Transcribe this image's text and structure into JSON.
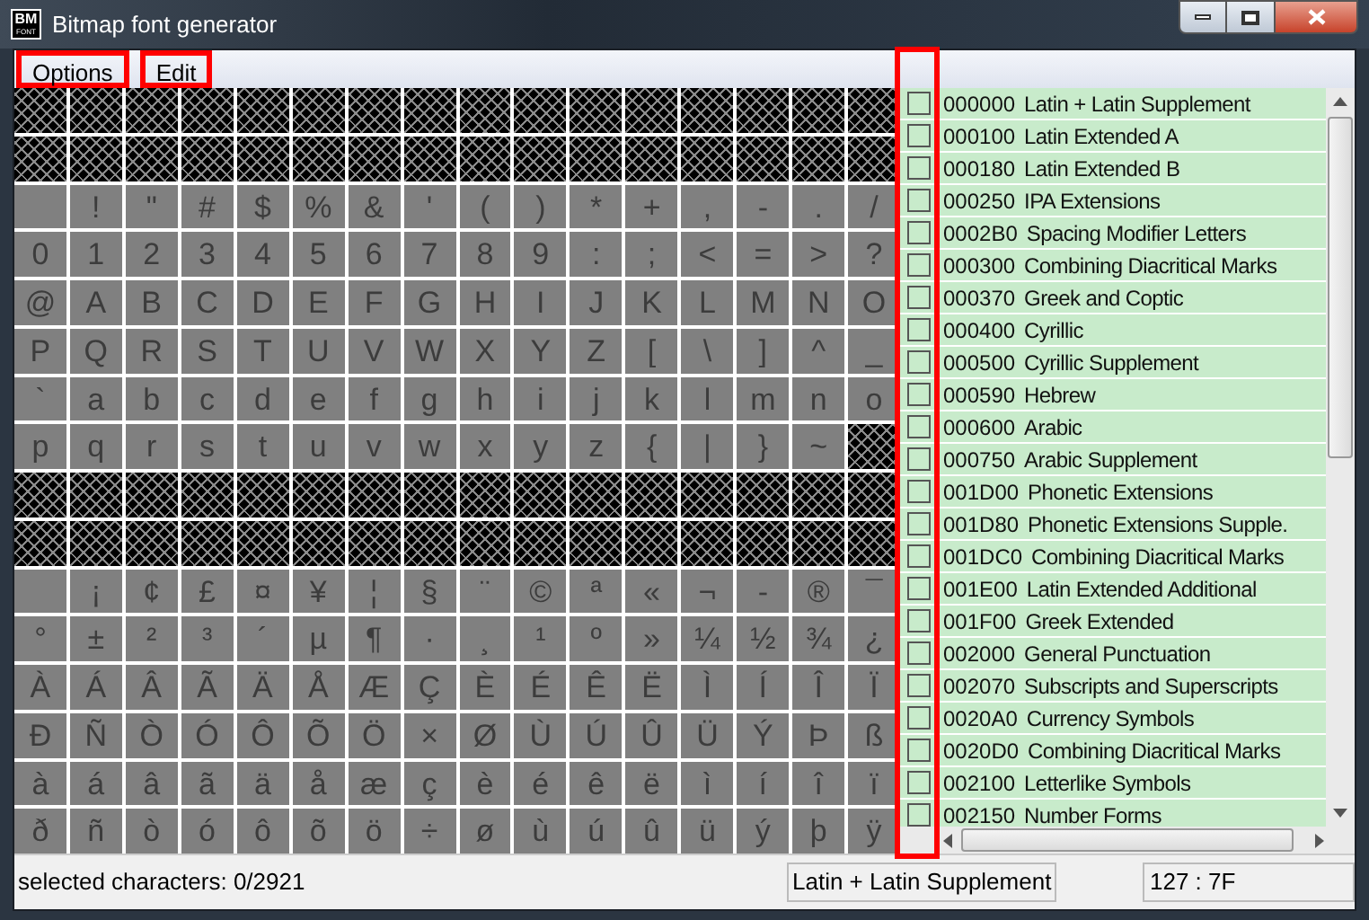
{
  "window": {
    "title": "Bitmap font generator",
    "app_icon": {
      "top": "BM",
      "bottom": "FONT"
    }
  },
  "menu": [
    {
      "label": "Options",
      "highlighted": true
    },
    {
      "label": "Edit",
      "highlighted": true
    }
  ],
  "glyph_grid": {
    "rows": [
      {
        "kind": "unavailable"
      },
      {
        "kind": "unavailable"
      },
      {
        "kind": "glyphs",
        "cells": [
          {
            "kind": "space"
          },
          {
            "kind": "glyph",
            "char": "!"
          },
          {
            "kind": "glyph",
            "char": "\""
          },
          {
            "kind": "glyph",
            "char": "#"
          },
          {
            "kind": "glyph",
            "char": "$"
          },
          {
            "kind": "glyph",
            "char": "%"
          },
          {
            "kind": "glyph",
            "char": "&"
          },
          {
            "kind": "glyph",
            "char": "'"
          },
          {
            "kind": "glyph",
            "char": "("
          },
          {
            "kind": "glyph",
            "char": ")"
          },
          {
            "kind": "glyph",
            "char": "*"
          },
          {
            "kind": "glyph",
            "char": "+"
          },
          {
            "kind": "glyph",
            "char": ","
          },
          {
            "kind": "glyph",
            "char": "-"
          },
          {
            "kind": "glyph",
            "char": "."
          },
          {
            "kind": "glyph",
            "char": "/"
          }
        ]
      },
      {
        "kind": "glyphs",
        "cells": [
          {
            "kind": "glyph",
            "char": "0"
          },
          {
            "kind": "glyph",
            "char": "1"
          },
          {
            "kind": "glyph",
            "char": "2"
          },
          {
            "kind": "glyph",
            "char": "3"
          },
          {
            "kind": "glyph",
            "char": "4"
          },
          {
            "kind": "glyph",
            "char": "5"
          },
          {
            "kind": "glyph",
            "char": "6"
          },
          {
            "kind": "glyph",
            "char": "7"
          },
          {
            "kind": "glyph",
            "char": "8"
          },
          {
            "kind": "glyph",
            "char": "9"
          },
          {
            "kind": "glyph",
            "char": ":"
          },
          {
            "kind": "glyph",
            "char": ";"
          },
          {
            "kind": "glyph",
            "char": "<"
          },
          {
            "kind": "glyph",
            "char": "="
          },
          {
            "kind": "glyph",
            "char": ">"
          },
          {
            "kind": "glyph",
            "char": "?"
          }
        ]
      },
      {
        "kind": "glyphs",
        "cells": [
          {
            "kind": "glyph",
            "char": "@"
          },
          {
            "kind": "glyph",
            "char": "A"
          },
          {
            "kind": "glyph",
            "char": "B"
          },
          {
            "kind": "glyph",
            "char": "C"
          },
          {
            "kind": "glyph",
            "char": "D"
          },
          {
            "kind": "glyph",
            "char": "E"
          },
          {
            "kind": "glyph",
            "char": "F"
          },
          {
            "kind": "glyph",
            "char": "G"
          },
          {
            "kind": "glyph",
            "char": "H"
          },
          {
            "kind": "glyph",
            "char": "I"
          },
          {
            "kind": "glyph",
            "char": "J"
          },
          {
            "kind": "glyph",
            "char": "K"
          },
          {
            "kind": "glyph",
            "char": "L"
          },
          {
            "kind": "glyph",
            "char": "M"
          },
          {
            "kind": "glyph",
            "char": "N"
          },
          {
            "kind": "glyph",
            "char": "O"
          }
        ]
      },
      {
        "kind": "glyphs",
        "cells": [
          {
            "kind": "glyph",
            "char": "P"
          },
          {
            "kind": "glyph",
            "char": "Q"
          },
          {
            "kind": "glyph",
            "char": "R"
          },
          {
            "kind": "glyph",
            "char": "S"
          },
          {
            "kind": "glyph",
            "char": "T"
          },
          {
            "kind": "glyph",
            "char": "U"
          },
          {
            "kind": "glyph",
            "char": "V"
          },
          {
            "kind": "glyph",
            "char": "W"
          },
          {
            "kind": "glyph",
            "char": "X"
          },
          {
            "kind": "glyph",
            "char": "Y"
          },
          {
            "kind": "glyph",
            "char": "Z"
          },
          {
            "kind": "glyph",
            "char": "["
          },
          {
            "kind": "glyph",
            "char": "\\"
          },
          {
            "kind": "glyph",
            "char": "]"
          },
          {
            "kind": "glyph",
            "char": "^"
          },
          {
            "kind": "glyph",
            "char": "_"
          }
        ]
      },
      {
        "kind": "glyphs",
        "cells": [
          {
            "kind": "glyph",
            "char": "`"
          },
          {
            "kind": "glyph",
            "char": "a"
          },
          {
            "kind": "glyph",
            "char": "b"
          },
          {
            "kind": "glyph",
            "char": "c"
          },
          {
            "kind": "glyph",
            "char": "d"
          },
          {
            "kind": "glyph",
            "char": "e"
          },
          {
            "kind": "glyph",
            "char": "f"
          },
          {
            "kind": "glyph",
            "char": "g"
          },
          {
            "kind": "glyph",
            "char": "h"
          },
          {
            "kind": "glyph",
            "char": "i"
          },
          {
            "kind": "glyph",
            "char": "j"
          },
          {
            "kind": "glyph",
            "char": "k"
          },
          {
            "kind": "glyph",
            "char": "l"
          },
          {
            "kind": "glyph",
            "char": "m"
          },
          {
            "kind": "glyph",
            "char": "n"
          },
          {
            "kind": "glyph",
            "char": "o"
          }
        ]
      },
      {
        "kind": "glyphs",
        "cells": [
          {
            "kind": "glyph",
            "char": "p"
          },
          {
            "kind": "glyph",
            "char": "q"
          },
          {
            "kind": "glyph",
            "char": "r"
          },
          {
            "kind": "glyph",
            "char": "s"
          },
          {
            "kind": "glyph",
            "char": "t"
          },
          {
            "kind": "glyph",
            "char": "u"
          },
          {
            "kind": "glyph",
            "char": "v"
          },
          {
            "kind": "glyph",
            "char": "w"
          },
          {
            "kind": "glyph",
            "char": "x"
          },
          {
            "kind": "glyph",
            "char": "y"
          },
          {
            "kind": "glyph",
            "char": "z"
          },
          {
            "kind": "glyph",
            "char": "{"
          },
          {
            "kind": "glyph",
            "char": "|"
          },
          {
            "kind": "glyph",
            "char": "}"
          },
          {
            "kind": "glyph",
            "char": "~"
          },
          {
            "kind": "unavailable"
          }
        ]
      },
      {
        "kind": "unavailable"
      },
      {
        "kind": "unavailable"
      },
      {
        "kind": "glyphs",
        "cells": [
          {
            "kind": "space"
          },
          {
            "kind": "glyph",
            "char": "¡"
          },
          {
            "kind": "glyph",
            "char": "¢"
          },
          {
            "kind": "glyph",
            "char": "£"
          },
          {
            "kind": "glyph",
            "char": "¤"
          },
          {
            "kind": "glyph",
            "char": "¥"
          },
          {
            "kind": "glyph",
            "char": "¦"
          },
          {
            "kind": "glyph",
            "char": "§"
          },
          {
            "kind": "glyph",
            "char": "¨"
          },
          {
            "kind": "glyph",
            "char": "©"
          },
          {
            "kind": "glyph",
            "char": "ª"
          },
          {
            "kind": "glyph",
            "char": "«"
          },
          {
            "kind": "glyph",
            "char": "¬"
          },
          {
            "kind": "glyph",
            "char": "-"
          },
          {
            "kind": "glyph",
            "char": "®"
          },
          {
            "kind": "glyph",
            "char": "¯"
          }
        ]
      },
      {
        "kind": "glyphs",
        "cells": [
          {
            "kind": "glyph",
            "char": "°"
          },
          {
            "kind": "glyph",
            "char": "±"
          },
          {
            "kind": "glyph",
            "char": "²"
          },
          {
            "kind": "glyph",
            "char": "³"
          },
          {
            "kind": "glyph",
            "char": "´"
          },
          {
            "kind": "glyph",
            "char": "µ"
          },
          {
            "kind": "glyph",
            "char": "¶"
          },
          {
            "kind": "glyph",
            "char": "·"
          },
          {
            "kind": "glyph",
            "char": "¸"
          },
          {
            "kind": "glyph",
            "char": "¹"
          },
          {
            "kind": "glyph",
            "char": "º"
          },
          {
            "kind": "glyph",
            "char": "»"
          },
          {
            "kind": "glyph",
            "char": "¼"
          },
          {
            "kind": "glyph",
            "char": "½"
          },
          {
            "kind": "glyph",
            "char": "¾"
          },
          {
            "kind": "glyph",
            "char": "¿"
          }
        ]
      },
      {
        "kind": "glyphs",
        "cells": [
          {
            "kind": "glyph",
            "char": "À"
          },
          {
            "kind": "glyph",
            "char": "Á"
          },
          {
            "kind": "glyph",
            "char": "Â"
          },
          {
            "kind": "glyph",
            "char": "Ã"
          },
          {
            "kind": "glyph",
            "char": "Ä"
          },
          {
            "kind": "glyph",
            "char": "Å"
          },
          {
            "kind": "glyph",
            "char": "Æ"
          },
          {
            "kind": "glyph",
            "char": "Ç"
          },
          {
            "kind": "glyph",
            "char": "È"
          },
          {
            "kind": "glyph",
            "char": "É"
          },
          {
            "kind": "glyph",
            "char": "Ê"
          },
          {
            "kind": "glyph",
            "char": "Ë"
          },
          {
            "kind": "glyph",
            "char": "Ì"
          },
          {
            "kind": "glyph",
            "char": "Í"
          },
          {
            "kind": "glyph",
            "char": "Î"
          },
          {
            "kind": "glyph",
            "char": "Ï"
          }
        ]
      },
      {
        "kind": "glyphs",
        "cells": [
          {
            "kind": "glyph",
            "char": "Ð"
          },
          {
            "kind": "glyph",
            "char": "Ñ"
          },
          {
            "kind": "glyph",
            "char": "Ò"
          },
          {
            "kind": "glyph",
            "char": "Ó"
          },
          {
            "kind": "glyph",
            "char": "Ô"
          },
          {
            "kind": "glyph",
            "char": "Õ"
          },
          {
            "kind": "glyph",
            "char": "Ö"
          },
          {
            "kind": "glyph",
            "char": "×"
          },
          {
            "kind": "glyph",
            "char": "Ø"
          },
          {
            "kind": "glyph",
            "char": "Ù"
          },
          {
            "kind": "glyph",
            "char": "Ú"
          },
          {
            "kind": "glyph",
            "char": "Û"
          },
          {
            "kind": "glyph",
            "char": "Ü"
          },
          {
            "kind": "glyph",
            "char": "Ý"
          },
          {
            "kind": "glyph",
            "char": "Þ"
          },
          {
            "kind": "glyph",
            "char": "ß"
          }
        ]
      },
      {
        "kind": "glyphs",
        "cells": [
          {
            "kind": "glyph",
            "char": "à"
          },
          {
            "kind": "glyph",
            "char": "á"
          },
          {
            "kind": "glyph",
            "char": "â"
          },
          {
            "kind": "glyph",
            "char": "ã"
          },
          {
            "kind": "glyph",
            "char": "ä"
          },
          {
            "kind": "glyph",
            "char": "å"
          },
          {
            "kind": "glyph",
            "char": "æ"
          },
          {
            "kind": "glyph",
            "char": "ç"
          },
          {
            "kind": "glyph",
            "char": "è"
          },
          {
            "kind": "glyph",
            "char": "é"
          },
          {
            "kind": "glyph",
            "char": "ê"
          },
          {
            "kind": "glyph",
            "char": "ë"
          },
          {
            "kind": "glyph",
            "char": "ì"
          },
          {
            "kind": "glyph",
            "char": "í"
          },
          {
            "kind": "glyph",
            "char": "î"
          },
          {
            "kind": "glyph",
            "char": "ï"
          }
        ]
      },
      {
        "kind": "glyphs",
        "cells": [
          {
            "kind": "glyph",
            "char": "ð"
          },
          {
            "kind": "glyph",
            "char": "ñ"
          },
          {
            "kind": "glyph",
            "char": "ò"
          },
          {
            "kind": "glyph",
            "char": "ó"
          },
          {
            "kind": "glyph",
            "char": "ô"
          },
          {
            "kind": "glyph",
            "char": "õ"
          },
          {
            "kind": "glyph",
            "char": "ö"
          },
          {
            "kind": "glyph",
            "char": "÷"
          },
          {
            "kind": "glyph",
            "char": "ø"
          },
          {
            "kind": "glyph",
            "char": "ù"
          },
          {
            "kind": "glyph",
            "char": "ú"
          },
          {
            "kind": "glyph",
            "char": "û"
          },
          {
            "kind": "glyph",
            "char": "ü"
          },
          {
            "kind": "glyph",
            "char": "ý"
          },
          {
            "kind": "glyph",
            "char": "þ"
          },
          {
            "kind": "glyph",
            "char": "ÿ"
          }
        ]
      }
    ]
  },
  "block_list": {
    "checkbox_column_highlighted": true,
    "items": [
      {
        "code": "000000",
        "name": "Latin + Latin Supplement",
        "checked": false
      },
      {
        "code": "000100",
        "name": "Latin Extended A",
        "checked": false
      },
      {
        "code": "000180",
        "name": "Latin Extended B",
        "checked": false
      },
      {
        "code": "000250",
        "name": "IPA Extensions",
        "checked": false
      },
      {
        "code": "0002B0",
        "name": "Spacing Modifier Letters",
        "checked": false
      },
      {
        "code": "000300",
        "name": "Combining Diacritical Marks",
        "checked": false
      },
      {
        "code": "000370",
        "name": "Greek and Coptic",
        "checked": false
      },
      {
        "code": "000400",
        "name": "Cyrillic",
        "checked": false
      },
      {
        "code": "000500",
        "name": "Cyrillic Supplement",
        "checked": false
      },
      {
        "code": "000590",
        "name": "Hebrew",
        "checked": false
      },
      {
        "code": "000600",
        "name": "Arabic",
        "checked": false
      },
      {
        "code": "000750",
        "name": "Arabic Supplement",
        "checked": false
      },
      {
        "code": "001D00",
        "name": "Phonetic Extensions",
        "checked": false
      },
      {
        "code": "001D80",
        "name": "Phonetic Extensions Supple.",
        "checked": false
      },
      {
        "code": "001DC0",
        "name": "Combining Diacritical Marks",
        "checked": false
      },
      {
        "code": "001E00",
        "name": "Latin Extended Additional",
        "checked": false
      },
      {
        "code": "001F00",
        "name": "Greek Extended",
        "checked": false
      },
      {
        "code": "002000",
        "name": "General Punctuation",
        "checked": false
      },
      {
        "code": "002070",
        "name": "Subscripts and Superscripts",
        "checked": false
      },
      {
        "code": "0020A0",
        "name": "Currency Symbols",
        "checked": false
      },
      {
        "code": "0020D0",
        "name": "Combining Diacritical Marks",
        "checked": false
      },
      {
        "code": "002100",
        "name": "Letterlike Symbols",
        "checked": false
      },
      {
        "code": "002150",
        "name": "Number Forms",
        "checked": false
      }
    ]
  },
  "status_bar": {
    "selection": "selected characters: 0/2921",
    "block": "Latin + Latin Supplement",
    "code": "127 : 7F"
  }
}
